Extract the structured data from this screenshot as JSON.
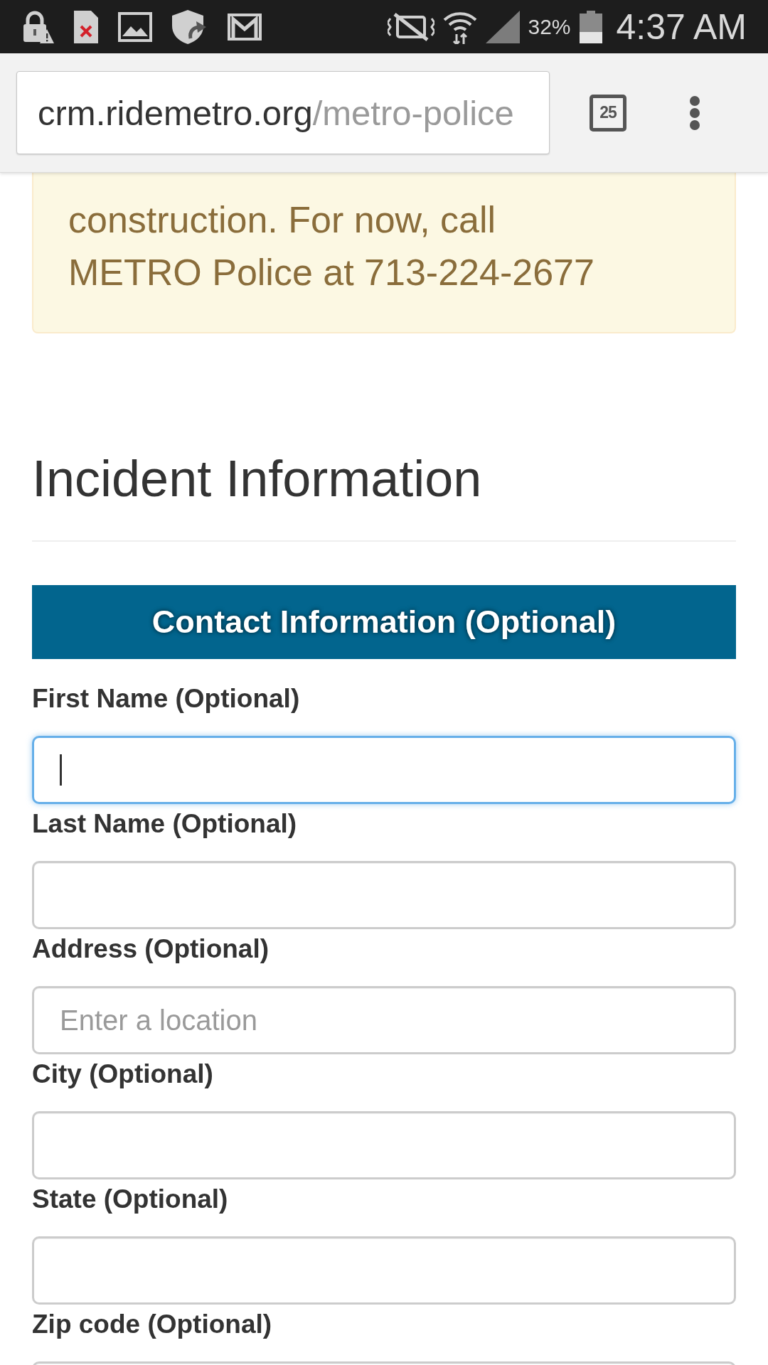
{
  "status_bar": {
    "battery_text": "32%",
    "time": "4:37 AM"
  },
  "browser": {
    "url_host": "crm.ridemetro.org",
    "url_path": "/metro-police",
    "tab_count": "25"
  },
  "notice": {
    "text": "construction. For now, call METRO Police at 713-224-2677"
  },
  "section_title": "Incident Information",
  "banner_title": "Contact Information (Optional)",
  "fields": [
    {
      "label": "First Name (Optional)",
      "focused": true
    },
    {
      "label": "Last Name (Optional)",
      "focused": false
    },
    {
      "label": "Address (Optional)",
      "focused": false,
      "placeholder": "Enter a location"
    },
    {
      "label": "City (Optional)",
      "focused": false
    },
    {
      "label": "State (Optional)",
      "focused": false
    },
    {
      "label": "Zip code (Optional)",
      "focused": false
    }
  ]
}
